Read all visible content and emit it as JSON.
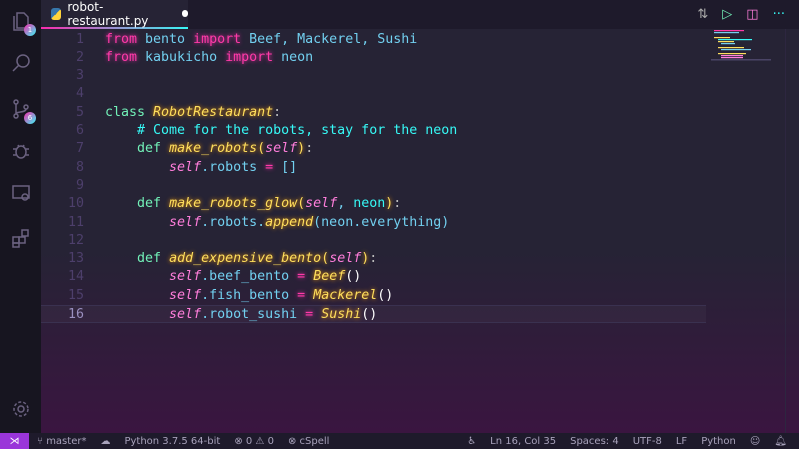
{
  "tab": {
    "filename": "robot-restaurant.py",
    "modified": true
  },
  "activity": {
    "explorer_badge": "1",
    "scm_badge": "6"
  },
  "lines": [
    {
      "n": "1",
      "tokens": [
        [
          "kw",
          "from"
        ],
        [
          "id",
          " bento "
        ],
        [
          "kw",
          "import"
        ],
        [
          "id",
          " Beef, Mackerel, Sushi"
        ]
      ]
    },
    {
      "n": "2",
      "tokens": [
        [
          "kw",
          "from"
        ],
        [
          "id",
          " kabukicho "
        ],
        [
          "kw",
          "import"
        ],
        [
          "id",
          " neon"
        ]
      ]
    },
    {
      "n": "3",
      "tokens": []
    },
    {
      "n": "4",
      "tokens": []
    },
    {
      "n": "5",
      "tokens": [
        [
          "cl",
          "class "
        ],
        [
          "cn",
          "RobotRestaurant"
        ],
        [
          "pl",
          ":"
        ]
      ]
    },
    {
      "n": "6",
      "tokens": [
        [
          "pl",
          "    "
        ],
        [
          "cm",
          "# Come for the robots, stay for the neon"
        ]
      ]
    },
    {
      "n": "7",
      "tokens": [
        [
          "pl",
          "    "
        ],
        [
          "cl",
          "def "
        ],
        [
          "cn",
          "make_robots"
        ],
        [
          "pn",
          "("
        ],
        [
          "sf",
          "self"
        ],
        [
          "pn",
          ")"
        ],
        [
          "pl",
          ":"
        ]
      ]
    },
    {
      "n": "8",
      "tokens": [
        [
          "pl",
          "        "
        ],
        [
          "sf",
          "self"
        ],
        [
          "id",
          ".robots "
        ],
        [
          "kw",
          "="
        ],
        [
          "id",
          " []"
        ]
      ]
    },
    {
      "n": "9",
      "tokens": []
    },
    {
      "n": "10",
      "tokens": [
        [
          "pl",
          "    "
        ],
        [
          "cl",
          "def "
        ],
        [
          "cn",
          "make_robots_glow"
        ],
        [
          "pn",
          "("
        ],
        [
          "sf",
          "self"
        ],
        [
          "id",
          ", "
        ],
        [
          "cm",
          "neon"
        ],
        [
          "pn",
          ")"
        ],
        [
          "pl",
          ":"
        ]
      ]
    },
    {
      "n": "11",
      "tokens": [
        [
          "pl",
          "        "
        ],
        [
          "sf",
          "self"
        ],
        [
          "id",
          ".robots."
        ],
        [
          "cn",
          "append"
        ],
        [
          "id",
          "(neon.everything)"
        ]
      ]
    },
    {
      "n": "12",
      "tokens": []
    },
    {
      "n": "13",
      "tokens": [
        [
          "pl",
          "    "
        ],
        [
          "cl",
          "def "
        ],
        [
          "cn",
          "add_expensive_bento"
        ],
        [
          "pn",
          "("
        ],
        [
          "sf",
          "self"
        ],
        [
          "pn",
          ")"
        ],
        [
          "pl",
          ":"
        ]
      ]
    },
    {
      "n": "14",
      "tokens": [
        [
          "pl",
          "        "
        ],
        [
          "sf",
          "self"
        ],
        [
          "id",
          ".beef_bento "
        ],
        [
          "kw",
          "="
        ],
        [
          "id",
          " "
        ],
        [
          "cn",
          "Beef"
        ],
        [
          "par",
          "()"
        ]
      ]
    },
    {
      "n": "15",
      "tokens": [
        [
          "pl",
          "        "
        ],
        [
          "sf",
          "self"
        ],
        [
          "id",
          ".fish_bento "
        ],
        [
          "kw",
          "="
        ],
        [
          "id",
          " "
        ],
        [
          "cn",
          "Mackerel"
        ],
        [
          "par",
          "()"
        ]
      ]
    },
    {
      "n": "16",
      "tokens": [
        [
          "pl",
          "        "
        ],
        [
          "sf",
          "self"
        ],
        [
          "id",
          ".robot_sushi "
        ],
        [
          "kw",
          "="
        ],
        [
          "id",
          " "
        ],
        [
          "cn",
          "Sushi"
        ],
        [
          "par",
          "()"
        ]
      ]
    }
  ],
  "current_line": "16",
  "status": {
    "branch": "master*",
    "python": "Python 3.7.5 64-bit",
    "errors": "0",
    "warnings": "0",
    "cspell": "cSpell",
    "position": "Ln 16, Col 35",
    "spaces": "Spaces: 4",
    "encoding": "UTF-8",
    "eol": "LF",
    "language": "Python"
  }
}
